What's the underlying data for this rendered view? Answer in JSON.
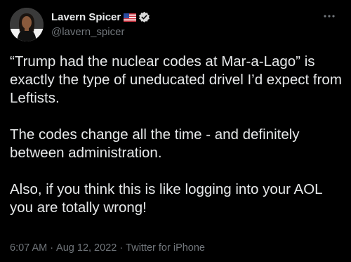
{
  "author": {
    "display_name": "Lavern Spicer",
    "handle": "@lavern_spicer",
    "flag_icon": "us-flag-icon",
    "verified_icon": "verified-badge-icon"
  },
  "more_icon": "more-options-icon",
  "tweet": {
    "paragraphs": [
      "“Trump had the nuclear codes at Mar-a-Lago” is exactly the type of uneducated drivel I’d expect from Leftists.",
      "The codes change all the time - and definitely between administration.",
      "Also, if you think this is like logging into your AOL you are totally wrong!"
    ]
  },
  "meta": {
    "time": "6:07 AM",
    "separator": "·",
    "date": "Aug 12, 2022",
    "source": "Twitter for iPhone"
  },
  "colors": {
    "background": "#000000",
    "text": "#e7e9ea",
    "secondary": "#71767b",
    "verified": "#d9d9d9"
  }
}
